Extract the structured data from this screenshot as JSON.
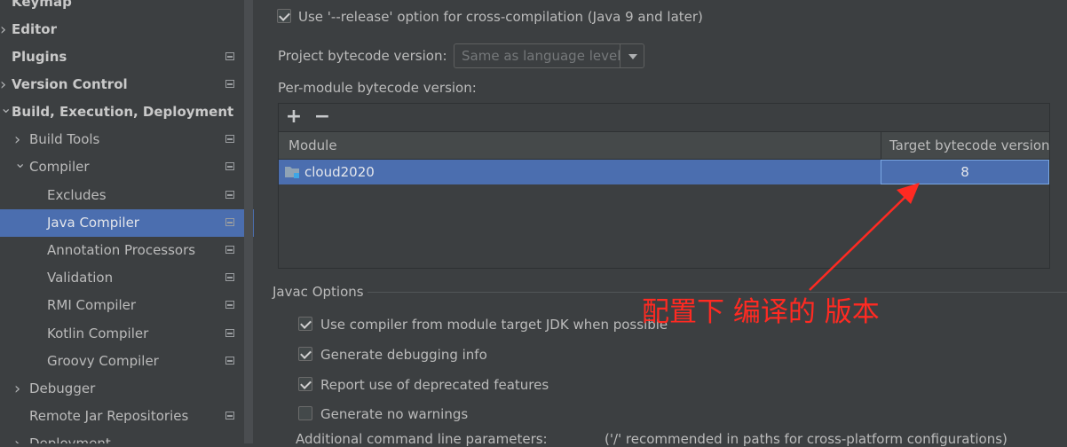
{
  "sidebar": {
    "items": [
      {
        "label": "Keymap",
        "bold": true,
        "chevron": "",
        "indent": 0
      },
      {
        "label": "Editor",
        "bold": true,
        "chevron": "right",
        "indent": 0
      },
      {
        "label": "Plugins",
        "bold": true,
        "chevron": "",
        "indent": 0,
        "project_icon": true
      },
      {
        "label": "Version Control",
        "bold": true,
        "chevron": "right",
        "indent": 0,
        "project_icon": true
      },
      {
        "label": "Build, Execution, Deployment",
        "bold": true,
        "chevron": "down",
        "indent": 0
      },
      {
        "label": "Build Tools",
        "bold": false,
        "chevron": "right",
        "indent": 1,
        "project_icon": true
      },
      {
        "label": "Compiler",
        "bold": false,
        "chevron": "down",
        "indent": 1,
        "project_icon": true
      },
      {
        "label": "Excludes",
        "bold": false,
        "chevron": "",
        "indent": 2,
        "project_icon": true
      },
      {
        "label": "Java Compiler",
        "bold": false,
        "chevron": "",
        "indent": 2,
        "project_icon": true,
        "selected": true
      },
      {
        "label": "Annotation Processors",
        "bold": false,
        "chevron": "",
        "indent": 2,
        "project_icon": true
      },
      {
        "label": "Validation",
        "bold": false,
        "chevron": "",
        "indent": 2,
        "project_icon": true
      },
      {
        "label": "RMI Compiler",
        "bold": false,
        "chevron": "",
        "indent": 2,
        "project_icon": true
      },
      {
        "label": "Kotlin Compiler",
        "bold": false,
        "chevron": "",
        "indent": 2,
        "project_icon": true
      },
      {
        "label": "Groovy Compiler",
        "bold": false,
        "chevron": "",
        "indent": 2,
        "project_icon": true
      },
      {
        "label": "Debugger",
        "bold": false,
        "chevron": "right",
        "indent": 1
      },
      {
        "label": "Remote Jar Repositories",
        "bold": false,
        "chevron": "",
        "indent": 1,
        "project_icon": true
      },
      {
        "label": "Deployment",
        "bold": false,
        "chevron": "right",
        "indent": 1
      }
    ]
  },
  "main": {
    "release_option": {
      "label": "Use '--release' option for cross-compilation (Java 9 and later)",
      "checked": true
    },
    "project_bytecode": {
      "label": "Project bytecode version:",
      "value": "Same as language level"
    },
    "per_module_label": "Per-module bytecode version:",
    "toolbar": {
      "add": "+",
      "remove": "−"
    },
    "table": {
      "headers": [
        "Module",
        "Target bytecode version"
      ],
      "rows": [
        {
          "module": "cloud2020",
          "target": "8"
        }
      ]
    },
    "javac_section_title": "Javac Options",
    "javac_options": [
      {
        "label": "Use compiler from module target JDK when possible",
        "checked": true
      },
      {
        "label": "Generate debugging info",
        "checked": true
      },
      {
        "label": "Report use of deprecated features",
        "checked": true
      },
      {
        "label": "Generate no warnings",
        "checked": false
      }
    ],
    "additional_params": {
      "label": "Additional command line parameters:",
      "hint": "('/' recommended in paths for cross-platform configurations)"
    },
    "annotation_text": "配置下 编译的 版本"
  },
  "colors": {
    "background": "#3c3f41",
    "selection": "#4b6eaf",
    "annotation": "#ff2a22"
  }
}
